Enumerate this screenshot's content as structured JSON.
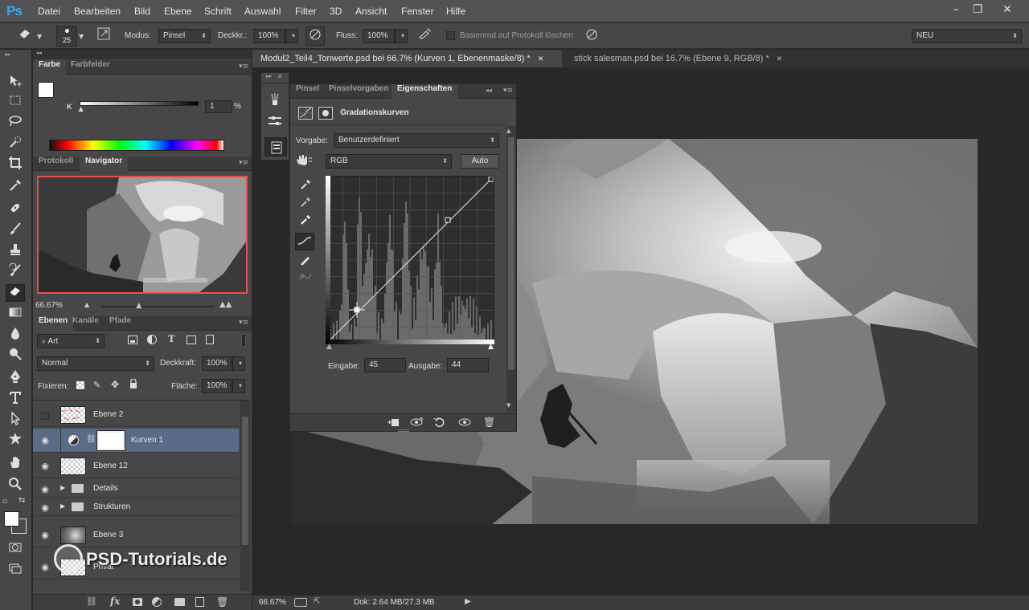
{
  "app": {
    "logo": "Ps",
    "menu": [
      "Datei",
      "Bearbeiten",
      "Bild",
      "Ebene",
      "Schrift",
      "Auswahl",
      "Filter",
      "3D",
      "Ansicht",
      "Fenster",
      "Hilfe"
    ],
    "window_controls": [
      "–",
      "❐",
      "✕"
    ]
  },
  "options_bar": {
    "brush_size": "25",
    "modus_label": "Modus:",
    "modus_value": "Pinsel",
    "deckkraft_label": "Deckkr.:",
    "deckkraft_value": "100%",
    "fluss_label": "Fluss:",
    "fluss_value": "100%",
    "protokoll_label": "Basierend auf Protokoll löschen",
    "workspace_value": "NEU"
  },
  "doc_tabs": [
    {
      "label": "Modul2_Teil4_Tonwerte.psd bei 66.7% (Kurven 1, Ebenenmaske/8) *",
      "close": "✕",
      "active": true
    },
    {
      "label": "stick salesman.psd bei 16.7% (Ebene 9, RGB/8) *",
      "close": "✕",
      "active": false
    }
  ],
  "color_panel": {
    "tabs": [
      "Farbe",
      "Farbfelder"
    ],
    "slider_label": "K",
    "slider_value": "1",
    "slider_unit": "%",
    "k_level": 0.01
  },
  "navigator_panel": {
    "tabs": [
      "Protokoll",
      "Navigator"
    ],
    "zoom": "66.67%",
    "zoom_level": 0.33
  },
  "layers_panel": {
    "tabs": [
      "Ebenen",
      "Kanäle",
      "Pfade"
    ],
    "filter_label": "Art",
    "blend_mode": "Normal",
    "deckkraft_label": "Deckkraft:",
    "deckkraft_value": "100%",
    "fixieren_label": "Fixieren:",
    "flaeche_label": "Fläche:",
    "flaeche_value": "100%",
    "layers": [
      {
        "name": "Ebene 2",
        "visible": false,
        "type": "pixel"
      },
      {
        "name": "Kurven 1",
        "visible": true,
        "type": "adjustment",
        "selected": true
      },
      {
        "name": "Ebene 12",
        "visible": true,
        "type": "pixel"
      },
      {
        "name": "Details",
        "visible": true,
        "type": "group"
      },
      {
        "name": "Strukturen",
        "visible": true,
        "type": "group"
      },
      {
        "name": "Ebene 3",
        "visible": true,
        "type": "pixel"
      },
      {
        "name": "Privat",
        "visible": true,
        "type": "pixel"
      }
    ]
  },
  "properties_panel": {
    "tabs": [
      "Pinsel",
      "Pinselvorgaben",
      "Eigenschaften"
    ],
    "title": "Gradationskurven",
    "vorgabe_label": "Vorgabe:",
    "vorgabe_value": "Benutzerdefiniert",
    "channel_value": "RGB",
    "auto_label": "Auto",
    "eingabe_label": "Eingabe:",
    "eingabe_value": "45",
    "ausgabe_label": "Ausgabe:",
    "ausgabe_value": "44"
  },
  "status_bar": {
    "zoom": "66.67%",
    "doc_info": "Dok: 2.64 MB/27.3 MB"
  },
  "watermark": "PSD-Tutorials.de"
}
